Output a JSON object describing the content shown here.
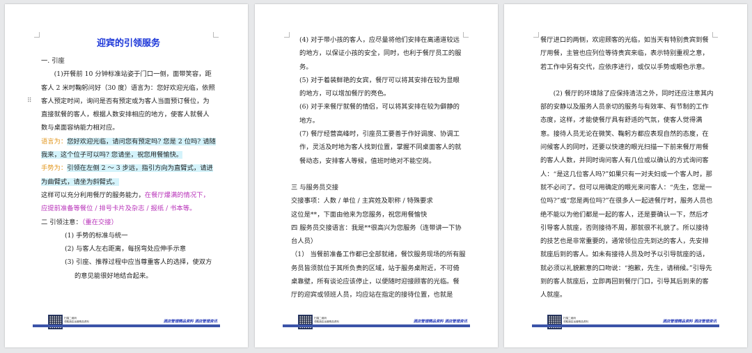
{
  "document": {
    "title": "迎宾的引领服务",
    "footer": {
      "small_line1": "扫描二维码",
      "small_line2": "领取酒店运营精品资料",
      "brand": "酒店管理精品资料 酒店管理资讯"
    },
    "page1": {
      "section1": "一. 引座",
      "p1": "(1)开餐前 10 分钟标准站姿于门口一侧，面带笑容，距客人 2 米时鞠躬问好（30 度）语言为：您好欢迎光临，依照客人预定时间，询问是否有预定或为客人当面预订餐位，为直接就餐的客人，根据人数安排相应的地方，使客人就餐人数与桌面容纳能力相对应。",
      "speech_label": "语言为：",
      "speech_text": "您好欢迎光临，请问您有预定吗? 您是 2 位吗? 请随我来，这个位子可以吗? 您请坐，祝您用餐愉快。",
      "gesture_label": "手势为：",
      "gesture_text": "引领在左侧 2 ～ 3 步远，指引方向为直臂式，请进为曲臂式，请坐为斜臂式。",
      "p_capacity_a": "这样可以充分利用餐厅的服务能力，",
      "p_capacity_b": "在餐厅爆满的情况下，应提前准备等餐位 / 排号卡片及杂志 / 报纸 / 书本等。",
      "section2_a": "二  引领注意：",
      "section2_b": "（重在交接）",
      "items": [
        "(1) 手势的标准与统一",
        "(2) 与客人左右距离，每拐弯处应伸手示意",
        "(3) 引座、推荐过程中应当尊重客人的选择，使双方的意见能很好地结合起来。"
      ]
    },
    "page2": {
      "items": [
        "(4) 对于带小孩的客人，应尽量将他们安排在离通道较远的地方，以保证小孩的安全，同时，也利于餐厅员工的服务。",
        "(5) 对于着装鲜艳的女宾，餐厅可以将其安排在较为显眼的地方，可以增加餐厅的亮色。",
        "(6) 对于来餐厅就餐的情侣，可以将其安排在较为僻静的地方。",
        "(7) 餐厅经营高峰时，引座员工要善于作好调度、协调工作，灵活及时地为客人找到位置，掌握不同桌面客人的就餐动态，安排客人等候，值班时绝对不能空岗。"
      ],
      "section3": "三  与服务员交接",
      "handover_items": "交接事项：人数 / 单位 / 主宾姓及职称 / 特殊要求",
      "handover_speech": "这位是**，下面由他来为您服务，祝您用餐愉快",
      "section4": "四 服务员交接语言：我是**很高兴为您服务（连带讲一下协台人员）",
      "p1": "（1）  当餐前准备工作都已全部就绪，餐饮服务现场的所有服务员皆须就位于其所负责的区域，站于服务桌附近，不可倚桌靠壁，所有谈论应该停止，以便随时迎接顾客的光临。餐厅的迎宾或领班人员，均应站在指定的接待位置，也就是"
    },
    "page3": {
      "p1": "餐厅进口的两侧，欢迎顾客的光临，如当天有特别贵宾到餐厅用餐，主管也应列位等待贵宾来临，表示特别重视之意，若工作中另有交代，应依序进行，或仅以手势或眼色示意。",
      "p2": "(2)  餐厅的环境除了应保持清洁之外，同时还应注意其内部的安静以及服务人员亲切的服务与有效率、有节制的工作态度，这样，才能使餐厅具有舒适的气氛，使客人觉得满意。接待人员无论在微笑、鞠躬方都应表现自然的态度，在问候客人的同时，还要以快速的眼光扫描一下前来餐厅用餐的客人人数，并同时询问客人有几位或以确认的方式询问客人：“是这几位客人吗?”如果只有一对夫妇或一个客人时，那就不必问了。但可以用确定的眼光来问客人：“先生，您是一位吗?”或“您是两位吗?”在很多人一起进餐厅时，服务人员也绝不能以为他们都是一起的客人，还是要确认一下，然后才引导客人就座，否则接待不周，那就很不礼貌了。所以接待的技艺也是非常重要的，通常领位应先到达的客人，先安排就座后到的客人。如未有接待人员及时予以引导就座的话，就必须以礼貌歉意的口吻说：“抱歉，先生，请稍候。”引导先到的客人就座后，立即再回到餐厅门口，引导其后到来的客人就座。"
    }
  }
}
